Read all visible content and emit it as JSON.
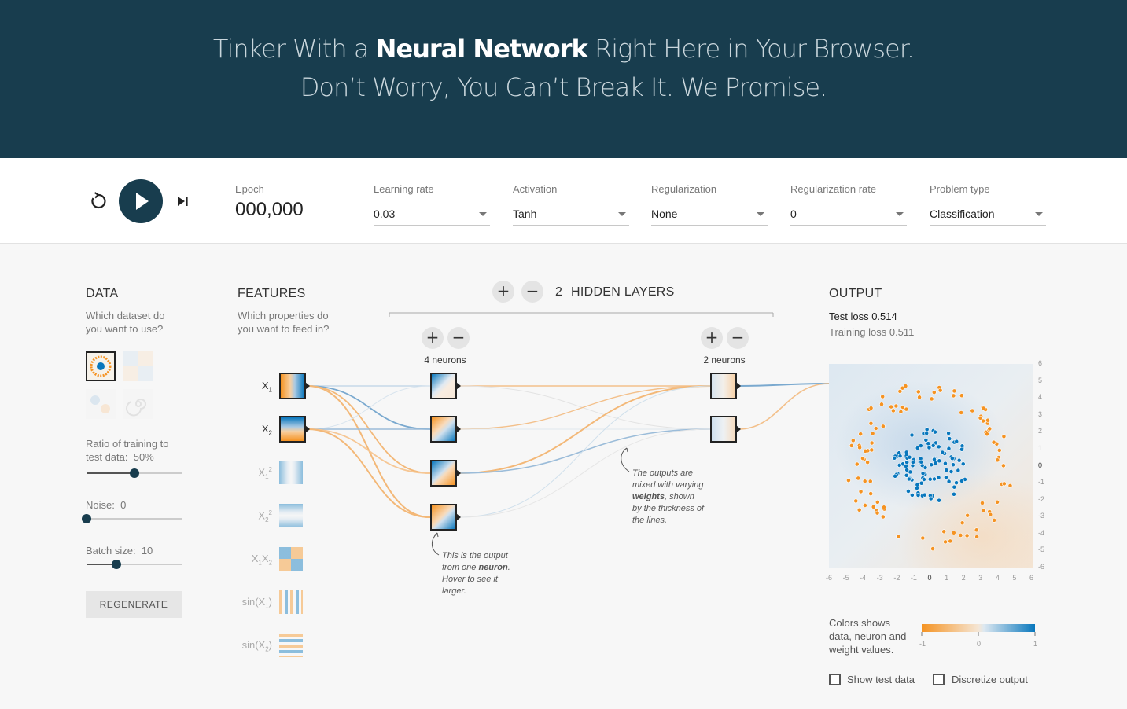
{
  "header": {
    "line1_pre": "Tinker With a ",
    "line1_bold": "Neural Network",
    "line1_post": " Right Here in Your Browser.",
    "line2": "Don’t Worry, You Can’t Break It. We Promise."
  },
  "controls": {
    "epoch_label": "Epoch",
    "epoch_value": "000,000",
    "learning_rate": {
      "label": "Learning rate",
      "value": "0.03"
    },
    "activation": {
      "label": "Activation",
      "value": "Tanh"
    },
    "regularization": {
      "label": "Regularization",
      "value": "None"
    },
    "regularization_rate": {
      "label": "Regularization rate",
      "value": "0"
    },
    "problem_type": {
      "label": "Problem type",
      "value": "Classification"
    }
  },
  "data_panel": {
    "title": "DATA",
    "subtitle_1": "Which dataset do",
    "subtitle_2": "you want to use?",
    "ratio_label": "Ratio of training to",
    "ratio_label_2": "test data:",
    "ratio_value": "50%",
    "ratio_fraction": 0.5,
    "noise_label": "Noise:",
    "noise_value": "0",
    "noise_fraction": 0,
    "batch_label": "Batch size:",
    "batch_value": "10",
    "batch_fraction": 0.31,
    "regenerate": "REGENERATE"
  },
  "features_panel": {
    "title": "FEATURES",
    "subtitle_1": "Which properties do",
    "subtitle_2": "you want to feed in?"
  },
  "network": {
    "hidden_layers_count": "2",
    "hidden_layers_label": "HIDDEN LAYERS",
    "layer1_label": "4 neurons",
    "layer2_label": "2 neurons",
    "note_neuron": [
      "This is the output",
      "from one ",
      "neuron",
      ".",
      "Hover to see it",
      "larger."
    ],
    "note_weights": [
      "The outputs are",
      "mixed with varying",
      "weights",
      ", shown",
      "by the thickness of",
      "the lines."
    ]
  },
  "output_panel": {
    "title": "OUTPUT",
    "test_loss_label": "Test loss",
    "test_loss_value": "0.514",
    "training_loss_label": "Training loss",
    "training_loss_value": "0.511",
    "legend_text_1": "Colors shows",
    "legend_text_2": "data, neuron and",
    "legend_text_3": "weight values.",
    "legend_min": "-1",
    "legend_mid": "0",
    "legend_max": "1",
    "show_test_data": "Show test data",
    "discretize_output": "Discretize output"
  },
  "colors": {
    "header_bg": "#183d4e",
    "orange": "#f59322",
    "blue": "#0877bd"
  }
}
